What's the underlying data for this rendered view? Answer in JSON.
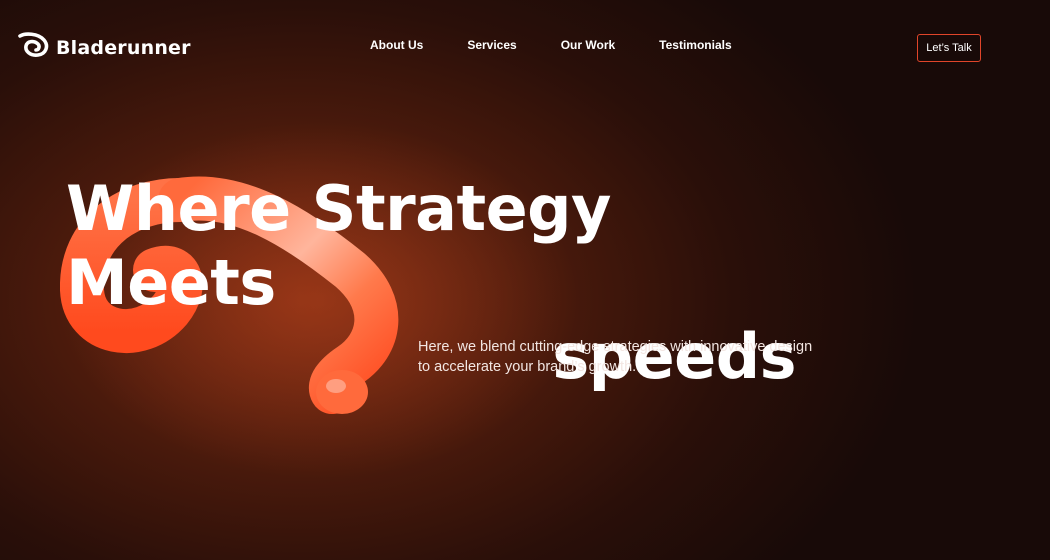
{
  "brand": {
    "name": "Bladerunner",
    "icon": "bladerunner-logo-icon"
  },
  "nav": {
    "items": [
      {
        "label": "About Us"
      },
      {
        "label": "Services"
      },
      {
        "label": "Our Work"
      },
      {
        "label": "Testimonials"
      }
    ]
  },
  "cta": {
    "label": "Let’s Talk",
    "border_color": "#e0452a"
  },
  "hero": {
    "headline_line1": "Where Strategy Meets",
    "headline_line2": "speeds",
    "subtitle": "Here, we blend cutting-edge strategies with innovative design to accelerate your brand’s growth.",
    "graphic": "orange-3d-ribbon",
    "accent_color": "#ff5a2e"
  },
  "colors": {
    "background": "#1d0b08",
    "glow": "#7a2a12",
    "text": "#ffffff"
  }
}
